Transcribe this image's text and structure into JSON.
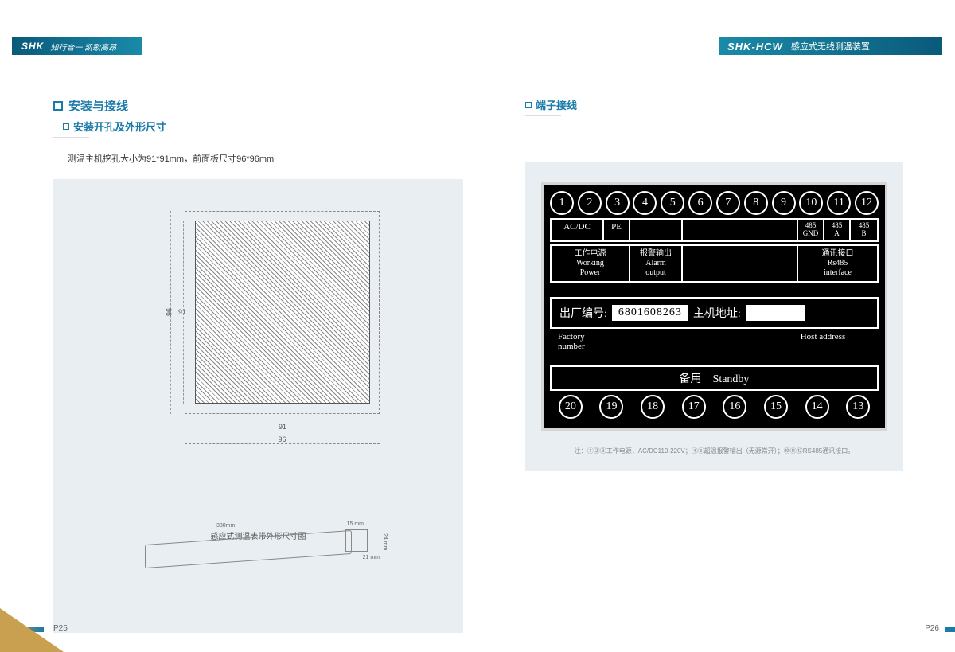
{
  "header": {
    "brand": "SHK",
    "slogan": "知行合一 凯歌高昂",
    "model": "SHK-HCW",
    "product": "感应式无线测温装置"
  },
  "left": {
    "title": "安装与接线",
    "subtitle": "安装开孔及外形尺寸",
    "desc": "测温主机挖孔大小为91*91mm，前面板尺寸96*96mm",
    "dim_96": "96",
    "dim_91": "91",
    "belt_380": "380mm",
    "belt_15": "15 mm",
    "belt_24": "24 mm",
    "belt_21": "21 mm",
    "belt_caption": "感应式测温表带外形尺寸图"
  },
  "right": {
    "title": "端子接线",
    "top_terminals": [
      "1",
      "2",
      "3",
      "4",
      "5",
      "6",
      "7",
      "8",
      "9",
      "10",
      "11",
      "12"
    ],
    "row1": {
      "acdc": "AC/DC",
      "pe": "PE",
      "gnd": "485\nGND",
      "a": "485\nA",
      "b": "485\nB"
    },
    "row2": {
      "power_cn": "工作电源",
      "power_en": "Working\nPower",
      "alarm_cn": "报警输出",
      "alarm_en": "Alarm\noutput",
      "comm_cn": "通讯接口",
      "comm_en": "Rs485\ninterface"
    },
    "serial_label": "出厂编号:",
    "serial_value": "6801608263",
    "addr_label": "主机地址:",
    "factory_en": "Factory\nnumber",
    "host_en": "Host address",
    "standby": "备用　Standby",
    "bottom_terminals": [
      "20",
      "19",
      "18",
      "17",
      "16",
      "15",
      "14",
      "13"
    ],
    "footnote": "注：①②③工作电源，AC/DC110-220V；④⑤超温报警输出（无源常开）；⑩⑪⑫RS485通讯接口。"
  },
  "pages": {
    "left": "P25",
    "right": "P26"
  }
}
